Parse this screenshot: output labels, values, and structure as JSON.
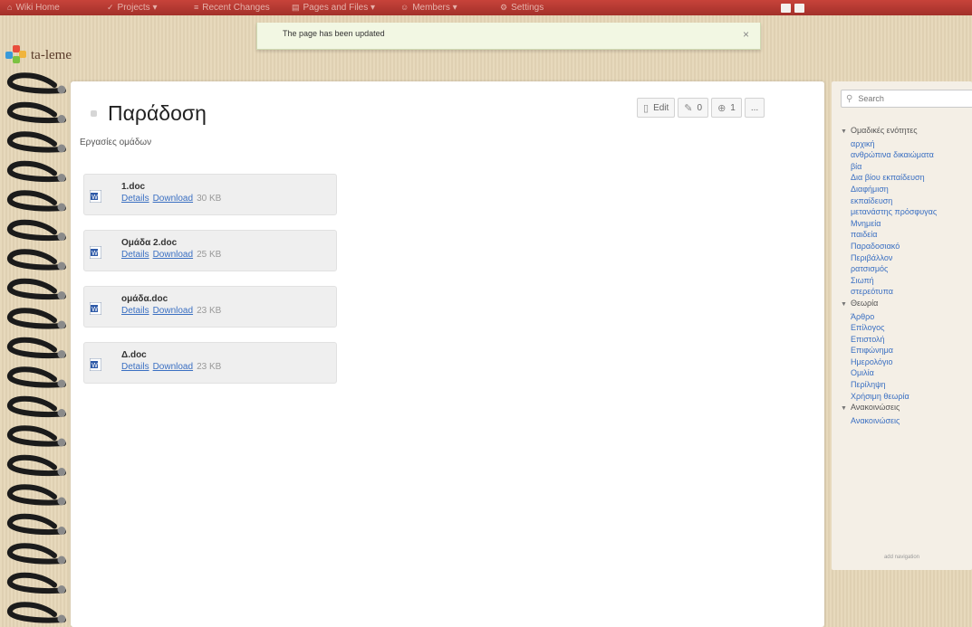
{
  "topbar": {
    "items": [
      {
        "icon": "home-icon",
        "label": "Wiki Home"
      },
      {
        "icon": "check-icon",
        "label": "Projects ▾"
      },
      {
        "icon": "list-icon",
        "label": "Recent Changes"
      },
      {
        "icon": "pages-icon",
        "label": "Pages and Files ▾"
      },
      {
        "icon": "members-icon",
        "label": "Members ▾"
      },
      {
        "icon": "gear-icon",
        "label": "Settings"
      }
    ]
  },
  "notification": {
    "message": "The page has been updated",
    "close": "×"
  },
  "logo": {
    "text": "ta-leme"
  },
  "page": {
    "title": "Παράδοση",
    "subtitle": "Εργασίες ομάδων",
    "toolbar": {
      "edit": "Edit",
      "comments": "0",
      "history": "1",
      "more": "..."
    },
    "files": [
      {
        "name": "1.doc",
        "details": "Details",
        "download": "Download",
        "size": "30 KB"
      },
      {
        "name": "Ομάδα 2.doc",
        "details": "Details",
        "download": "Download",
        "size": "25 KB"
      },
      {
        "name": "ομάδα.doc",
        "details": "Details",
        "download": "Download",
        "size": "23 KB"
      },
      {
        "name": "Δ.doc",
        "details": "Details",
        "download": "Download",
        "size": "23 KB"
      }
    ]
  },
  "sidebar": {
    "search_placeholder": "Search",
    "categories": [
      {
        "label": "Ομαδικές ενότητες",
        "items": [
          "αρχική",
          "ανθρώπινα δικαιώματα",
          "βία",
          "Δια βίου εκπαίδευση",
          "Διαφήμιση",
          "εκπαίδευση",
          "μετανάστης πρόσφυγας",
          "Μνημεία",
          "παιδεία",
          "Παραδοσιακό",
          "Περιβάλλον",
          "ρατσισμός",
          "Σιωπή",
          "στερεότυπα"
        ]
      },
      {
        "label": "Θεωρία",
        "items": [
          "Άρθρο",
          "Επίλογος",
          "Επιστολή",
          "Επιφώνημα",
          "Ημερολόγιο",
          "Ομιλία",
          "Περίληψη",
          "Χρήσιμη θεωρία"
        ]
      },
      {
        "label": "Ανακοινώσεις",
        "items": [
          "Ανακοινώσεις"
        ]
      }
    ],
    "add_navigation": "add navigation"
  },
  "colors": {
    "topbar": "#b3382f",
    "link": "#3a6fc2",
    "notification_bg": "#f2f7e3",
    "background": "#e6d7b8"
  }
}
